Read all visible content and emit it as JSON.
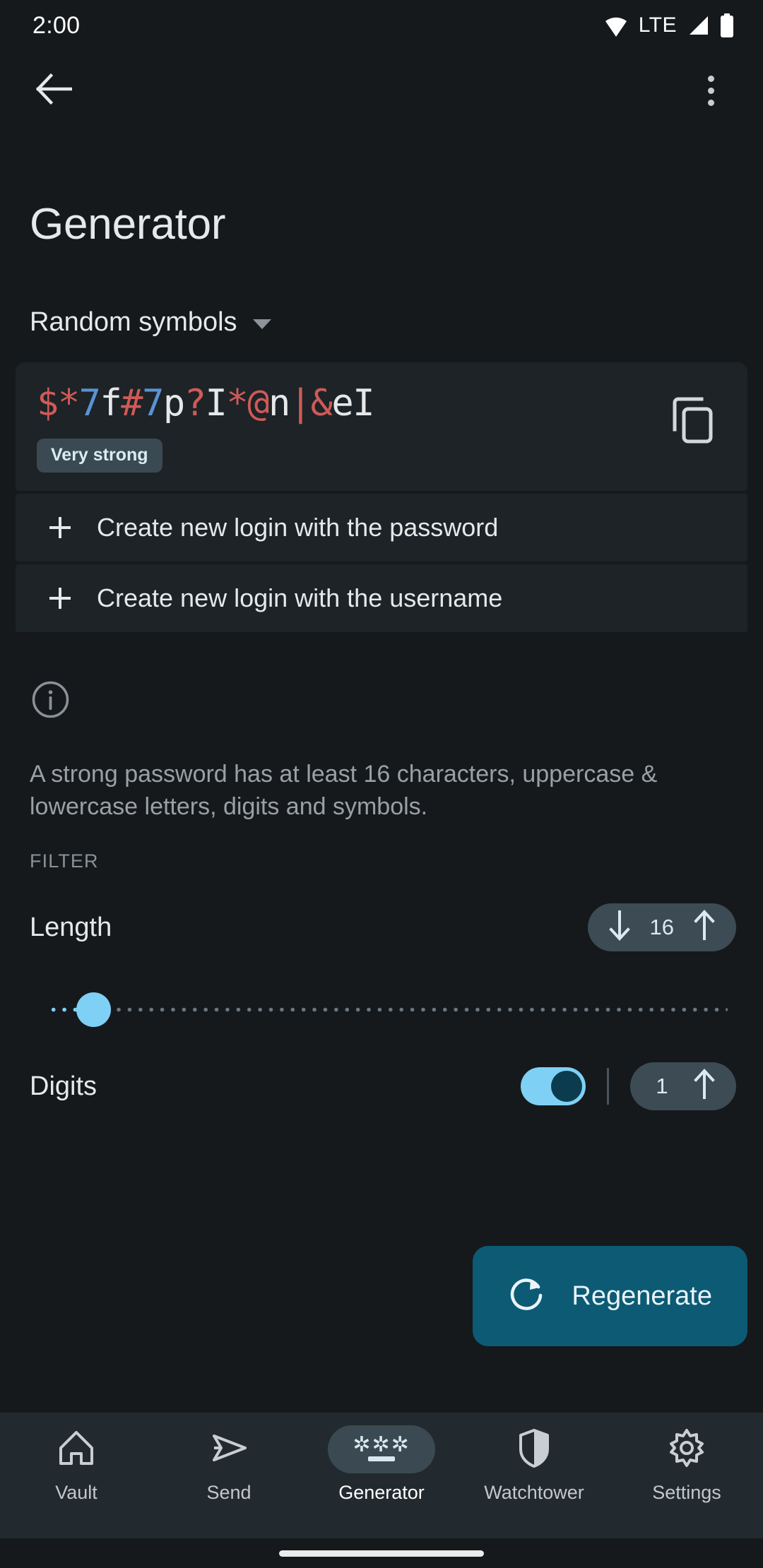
{
  "status_bar": {
    "clock": "2:00",
    "network_label": "LTE",
    "icons": [
      "wifi-icon",
      "signal-icon",
      "battery-icon"
    ]
  },
  "app_bar": {
    "back_icon": "back-arrow-icon",
    "overflow_icon": "more-vertical-icon"
  },
  "page": {
    "title": "Generator"
  },
  "type_selector": {
    "value": "Random symbols",
    "caret_icon": "chevron-down-icon"
  },
  "password": {
    "value": "$*7f#7p?I*@n|&eI",
    "characters": [
      {
        "c": "$",
        "kind": "sym"
      },
      {
        "c": "*",
        "kind": "sym"
      },
      {
        "c": "7",
        "kind": "num"
      },
      {
        "c": "f",
        "kind": "ltr"
      },
      {
        "c": "#",
        "kind": "sym"
      },
      {
        "c": "7",
        "kind": "num"
      },
      {
        "c": "p",
        "kind": "ltr"
      },
      {
        "c": "?",
        "kind": "sym"
      },
      {
        "c": "I",
        "kind": "ltr"
      },
      {
        "c": "*",
        "kind": "sym"
      },
      {
        "c": "@",
        "kind": "sym"
      },
      {
        "c": "n",
        "kind": "ltr"
      },
      {
        "c": "|",
        "kind": "sym"
      },
      {
        "c": "&",
        "kind": "sym"
      },
      {
        "c": "e",
        "kind": "ltr"
      },
      {
        "c": "I",
        "kind": "ltr"
      }
    ],
    "strength_label": "Very strong",
    "copy_icon": "copy-icon"
  },
  "actions": [
    {
      "label": "Create new login with the password",
      "icon": "plus-icon"
    },
    {
      "label": "Create new login with the username",
      "icon": "plus-icon"
    }
  ],
  "info": {
    "icon": "info-circle-icon",
    "text": "A strong password has at least 16 characters, uppercase & lowercase letters, digits and symbols."
  },
  "filter": {
    "section_label": "FILTER",
    "length": {
      "label": "Length",
      "value": "16",
      "decrement_icon": "arrow-down-icon",
      "increment_icon": "arrow-up-icon"
    },
    "digits": {
      "label": "Digits",
      "toggle_on": true,
      "value": "1",
      "increment_icon": "arrow-up-icon"
    }
  },
  "regenerate": {
    "label": "Regenerate",
    "icon": "refresh-icon"
  },
  "bottom_nav": {
    "items": [
      {
        "label": "Vault",
        "icon": "home-icon",
        "active": false
      },
      {
        "label": "Send",
        "icon": "send-icon",
        "active": false
      },
      {
        "label": "Generator",
        "icon": "generator-icon",
        "active": true
      },
      {
        "label": "Watchtower",
        "icon": "shield-icon",
        "active": false
      },
      {
        "label": "Settings",
        "icon": "gear-icon",
        "active": false
      }
    ]
  },
  "colors": {
    "background": "#16191c",
    "surface": "#1d2326",
    "nav_background": "#222a2f",
    "accent_blue": "#7fd0f5",
    "fab": "#0d5a75",
    "symbol_red": "#cf5a58",
    "digit_blue": "#5a93d4",
    "badge_bg": "#3b4a52"
  }
}
